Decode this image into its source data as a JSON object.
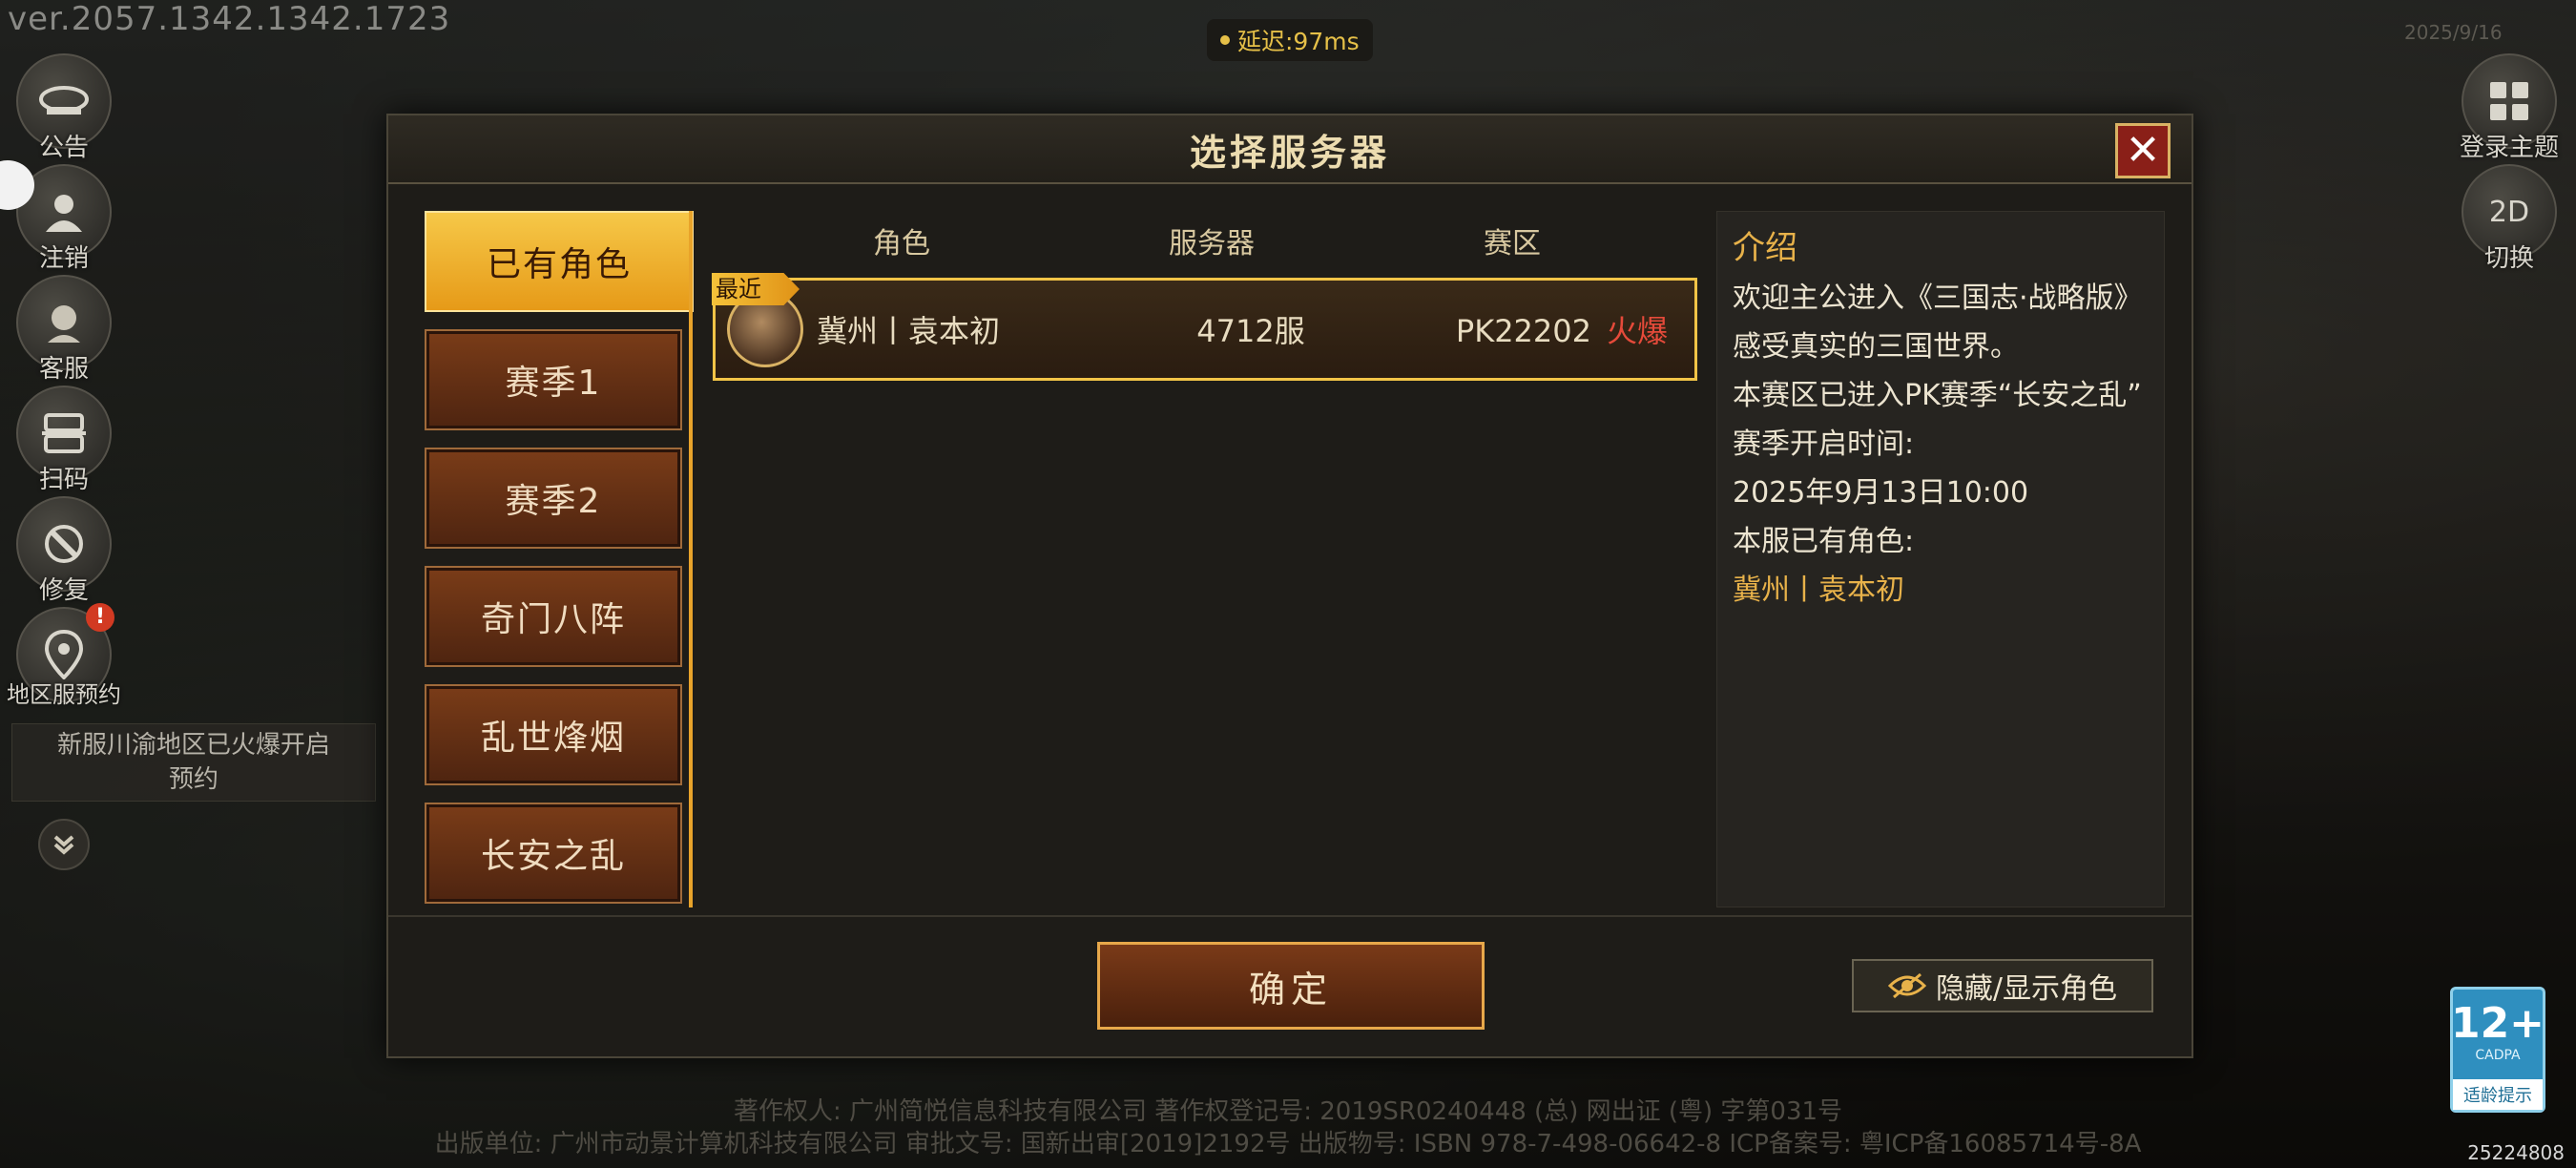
{
  "version": "ver.2057.1342.1342.1723",
  "latency": "延迟:97ms",
  "left_sidebar": {
    "announcement": "公告",
    "logout": "注销",
    "customer_service": "客服",
    "scan": "扫码",
    "repair": "修复",
    "region_reserve": "地区服预约",
    "notice": {
      "line1": "新服川渝地区已火爆开启",
      "line2": "预约"
    }
  },
  "right_sidebar": {
    "login_theme": "登录主题",
    "switch": "切换",
    "switch_badge": "2D"
  },
  "modal": {
    "title": "选择服务器",
    "tabs": [
      "已有角色",
      "赛季1",
      "赛季2",
      "奇门八阵",
      "乱世烽烟",
      "长安之乱"
    ],
    "active_tab": 0,
    "columns": {
      "role": "角色",
      "server": "服务器",
      "zone": "赛区"
    },
    "rows": [
      {
        "tag": "最近",
        "role": "冀州丨袁本初",
        "server": "4712服",
        "zone": "PK22202",
        "status": "火爆"
      }
    ],
    "intro": {
      "title": "介绍",
      "p1": "欢迎主公进入《三国志·战略版》感受真实的三国世界。",
      "p2": "本赛区已进入PK赛季“长安之乱”",
      "p3": "赛季开启时间:",
      "p4": "2025年9月13日10:00",
      "p5": "本服已有角色:",
      "p6": "冀州丨袁本初"
    },
    "confirm": "确定",
    "toggle_roles": "隐藏/显示角色"
  },
  "age_rating": {
    "num": "12+",
    "org": "CADPA",
    "tip": "适龄提示"
  },
  "footer": {
    "line1": "著作权人: 广州简悦信息科技有限公司    著作权登记号: 2019SR0240448    (总) 网出证 (粤) 字第031号",
    "line2": "出版单位: 广州市动景计算机科技有限公司 审批文号: 国新出审[2019]2192号 出版物号: ISBN 978-7-498-06642-8 ICP备案号: 粤ICP备16085714号-8A"
  },
  "build_id": "25224808",
  "colors": {
    "accent": "#f2c447",
    "hot": "#e54a3a",
    "tab_active": "#f6c848"
  }
}
